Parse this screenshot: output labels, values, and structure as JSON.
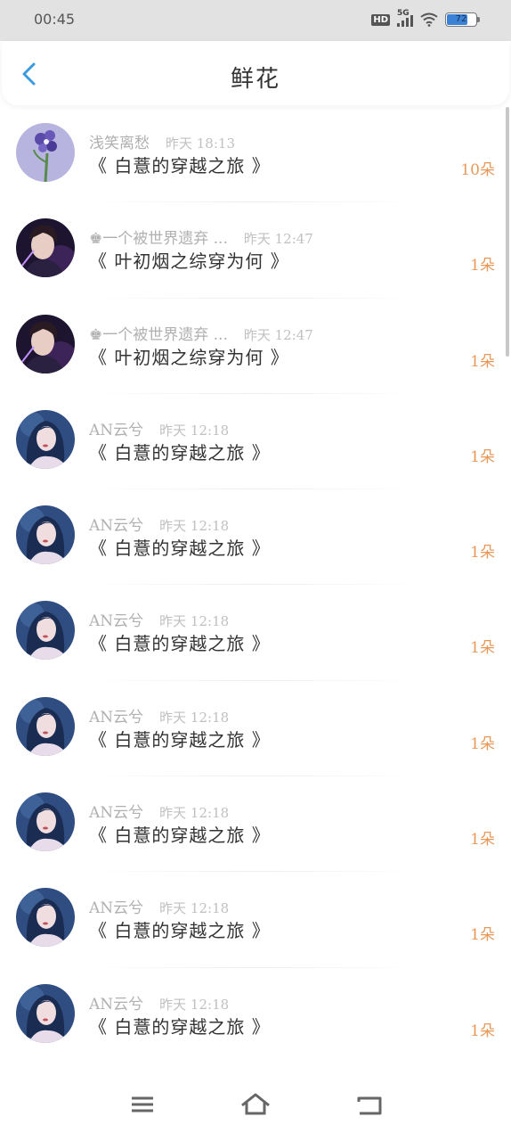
{
  "status_bar": {
    "time": "00:45",
    "hd": "HD",
    "network": "5G",
    "battery": "72",
    "battery_level": 0.72
  },
  "header": {
    "title": "鲜花",
    "back_icon": "chevron-left-icon"
  },
  "colors": {
    "accent": "#3b9be0",
    "count": "#e8995a",
    "meta": "#b0b0b0"
  },
  "items": [
    {
      "name": "浅笑离愁",
      "time": "昨天 18:13",
      "book": "《 白薏的穿越之旅 》",
      "count": "10朵",
      "avatar": "purple-flowers"
    },
    {
      "name": "♚一个被世界遗弃 ...",
      "time": "昨天 12:47",
      "book": "《 叶初烟之综穿为何 》",
      "count": "1朵",
      "avatar": "dark-boy"
    },
    {
      "name": "♚一个被世界遗弃 ...",
      "time": "昨天 12:47",
      "book": "《 叶初烟之综穿为何 》",
      "count": "1朵",
      "avatar": "dark-boy"
    },
    {
      "name": "AN云兮",
      "time": "昨天 12:18",
      "book": "《 白薏的穿越之旅 》",
      "count": "1朵",
      "avatar": "blue-girl"
    },
    {
      "name": "AN云兮",
      "time": "昨天 12:18",
      "book": "《 白薏的穿越之旅 》",
      "count": "1朵",
      "avatar": "blue-girl"
    },
    {
      "name": "AN云兮",
      "time": "昨天 12:18",
      "book": "《 白薏的穿越之旅 》",
      "count": "1朵",
      "avatar": "blue-girl"
    },
    {
      "name": "AN云兮",
      "time": "昨天 12:18",
      "book": "《 白薏的穿越之旅 》",
      "count": "1朵",
      "avatar": "blue-girl"
    },
    {
      "name": "AN云兮",
      "time": "昨天 12:18",
      "book": "《 白薏的穿越之旅 》",
      "count": "1朵",
      "avatar": "blue-girl"
    },
    {
      "name": "AN云兮",
      "time": "昨天 12:18",
      "book": "《 白薏的穿越之旅 》",
      "count": "1朵",
      "avatar": "blue-girl"
    },
    {
      "name": "AN云兮",
      "time": "昨天 12:18",
      "book": "《 白薏的穿越之旅 》",
      "count": "1朵",
      "avatar": "blue-girl"
    }
  ],
  "nav_bar": {
    "menu_icon": "menu-icon",
    "home_icon": "home-icon",
    "back_icon": "back-icon"
  }
}
